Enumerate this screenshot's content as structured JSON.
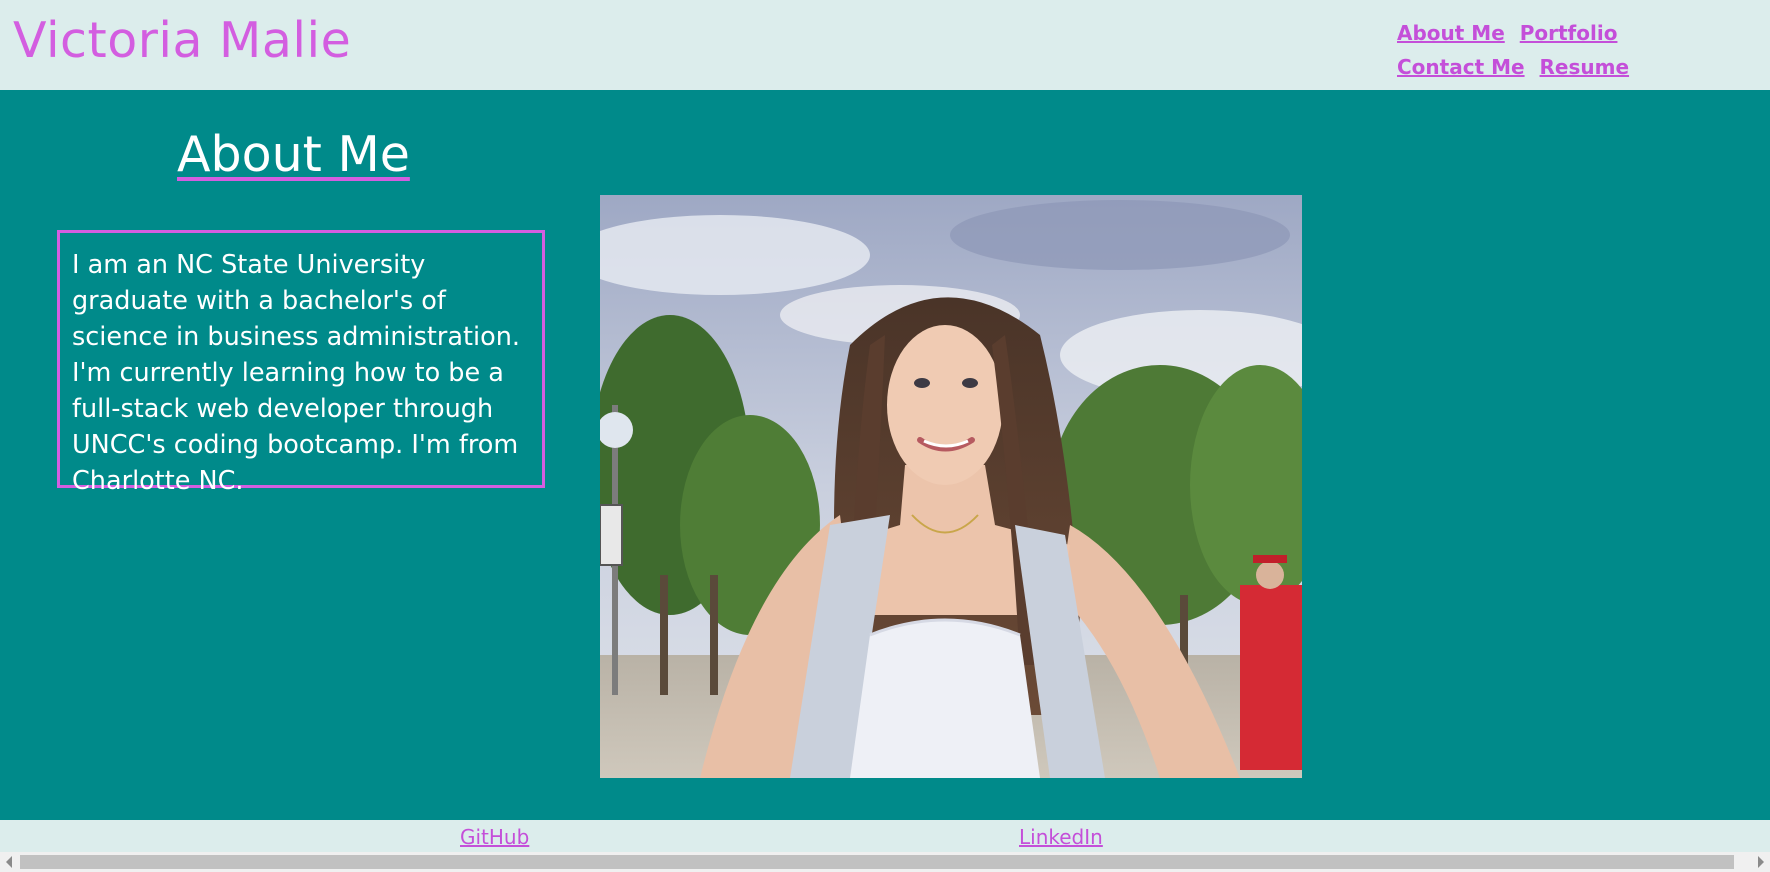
{
  "header": {
    "site_title": "Victoria Malie",
    "nav": [
      {
        "label": "About Me"
      },
      {
        "label": "Portfolio"
      },
      {
        "label": "Contact Me"
      },
      {
        "label": "Resume"
      }
    ]
  },
  "main": {
    "heading": "About Me",
    "bio": "I am an NC State University graduate with a bachelor's of science in business administration. I'm currently learning how to be a full-stack web developer through UNCC's coding bootcamp. I'm from Charlotte NC."
  },
  "footer": {
    "links": [
      {
        "label": "GitHub"
      },
      {
        "label": "LinkedIn"
      }
    ]
  },
  "colors": {
    "header_bg": "#dcedec",
    "main_bg": "#008a8a",
    "accent": "#d35ee0",
    "link": "#c44fd9",
    "text_light": "#ffffff"
  }
}
